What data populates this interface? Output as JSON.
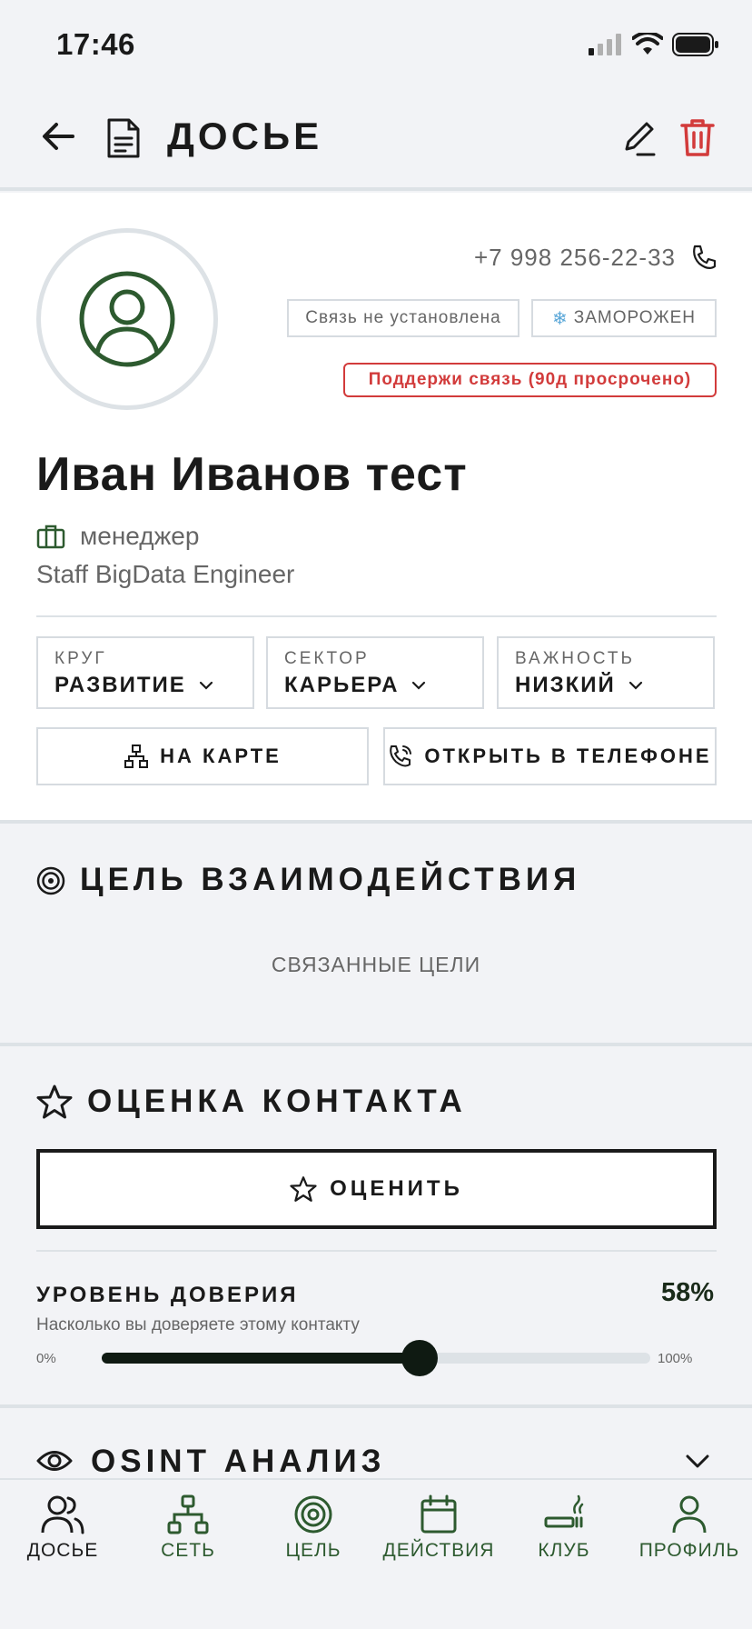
{
  "status_bar": {
    "time": "17:46"
  },
  "header": {
    "title": "ДОСЬЕ"
  },
  "contact": {
    "phone": "+7 998 256-22-33",
    "badges": {
      "connection": "Связь не установлена",
      "frozen": "ЗАМОРОЖЕН",
      "alert": "Поддержи связь (90д просрочено)"
    },
    "name": "Иван Иванов тест",
    "role": "менеджер",
    "job_title": "Staff BigData Engineer"
  },
  "selectors": {
    "circle": {
      "label": "КРУГ",
      "value": "РАЗВИТИЕ"
    },
    "sector": {
      "label": "СЕКТОР",
      "value": "КАРЬЕРА"
    },
    "importance": {
      "label": "ВАЖНОСТЬ",
      "value": "НИЗКИЙ"
    }
  },
  "actions": {
    "map": "НА КАРТЕ",
    "open_phone": "ОТКРЫТЬ В ТЕЛЕФОНЕ"
  },
  "goal_section": {
    "title": "ЦЕЛЬ ВЗАИМОДЕЙСТВИЯ",
    "linked_goals": "СВЯЗАННЫЕ ЦЕЛИ"
  },
  "rating_section": {
    "title": "ОЦЕНКА КОНТАКТА",
    "rate_button": "ОЦЕНИТЬ",
    "trust_label": "УРОВЕНЬ ДОВЕРИЯ",
    "trust_value_text": "58%",
    "trust_value": 58,
    "trust_description": "Насколько вы доверяете этому контакту",
    "slider_min": "0%",
    "slider_max": "100%"
  },
  "osint_section": {
    "title": "OSINT АНАЛИЗ"
  },
  "bottom_nav": {
    "items": [
      {
        "label": "ДОСЬЕ",
        "icon": "people-icon"
      },
      {
        "label": "СЕТЬ",
        "icon": "network-icon"
      },
      {
        "label": "ЦЕЛЬ",
        "icon": "target-icon"
      },
      {
        "label": "ДЕЙСТВИЯ",
        "icon": "calendar-icon"
      },
      {
        "label": "КЛУБ",
        "icon": "cigar-icon"
      },
      {
        "label": "ПРОФИЛЬ",
        "icon": "profile-icon"
      }
    ]
  },
  "colors": {
    "accent_green": "#2d5a2f",
    "danger_red": "#d23b3b",
    "dark": "#0f1a12",
    "border": "#dde2e6"
  }
}
